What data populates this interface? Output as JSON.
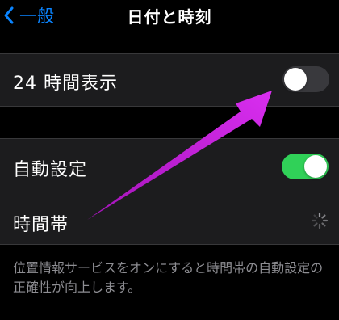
{
  "nav": {
    "back_label": "一般",
    "title": "日付と時刻"
  },
  "settings": {
    "hour24": {
      "label": "24 時間表示",
      "enabled": false
    },
    "auto_set": {
      "label": "自動設定",
      "enabled": true
    },
    "timezone": {
      "label": "時間帯",
      "status": "loading"
    }
  },
  "footer": {
    "note": "位置情報サービスをオンにすると時間帯の自動設定の正確性が向上します。"
  },
  "colors": {
    "accent_blue": "#0a84ff",
    "toggle_on": "#30d158",
    "annotation_arrow": "#c41fd9"
  },
  "icons": {
    "back": "chevron-left-icon",
    "loading": "spinner-icon",
    "annotation": "arrow-annotation"
  }
}
